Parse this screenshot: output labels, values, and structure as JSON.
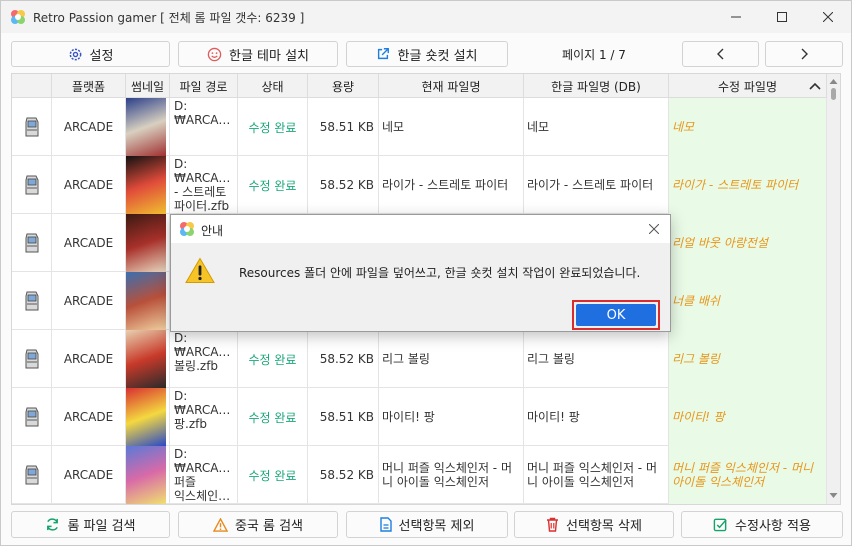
{
  "window": {
    "title": "Retro Passion gamer [ 전체 롬 파일 갯수: 6239 ]"
  },
  "toolbar": {
    "settings_label": "설정",
    "korean_theme_label": "한글 테마 설치",
    "korean_shortcut_label": "한글 숏컷 설치",
    "page_info": "페이지 1 / 7"
  },
  "table": {
    "columns": [
      "플랫폼",
      "썸네일",
      "파일 경로",
      "상태",
      "용량",
      "현재 파일명",
      "한글 파일명 (DB)",
      "수정 파일명"
    ],
    "rows": [
      {
        "platform": "ARCADE",
        "path": "D:\n₩ARCA…",
        "status": "수정 완료",
        "size": "58.51 KB",
        "current": "네모",
        "db": "네모",
        "fixed": "네모"
      },
      {
        "platform": "ARCADE",
        "path": "D:\n₩ARCA…\n- 스트레토\n파이터.zfb",
        "status": "수정 완료",
        "size": "58.52 KB",
        "current": "라이가 - 스트레토 파이터",
        "db": "라이가 - 스트레토 파이터",
        "fixed": "라이가 - 스트레토 파이터"
      },
      {
        "platform": "ARCADE",
        "path": "",
        "status": "",
        "size": "",
        "current": "",
        "db": "",
        "fixed": "리얼 바웃 아랑전설"
      },
      {
        "platform": "ARCADE",
        "path": "",
        "status": "",
        "size": "",
        "current": "",
        "db": "",
        "fixed": "너클 배쉬"
      },
      {
        "platform": "ARCADE",
        "path": "D:\n₩ARCA…\n볼링.zfb",
        "status": "수정 완료",
        "size": "58.52 KB",
        "current": "리그 볼링",
        "db": "리그 볼링",
        "fixed": "리그 볼링"
      },
      {
        "platform": "ARCADE",
        "path": "D:\n₩ARCA…\n팡.zfb",
        "status": "수정 완료",
        "size": "58.51 KB",
        "current": "마이티! 팡",
        "db": "마이티! 팡",
        "fixed": "마이티! 팡"
      },
      {
        "platform": "ARCADE",
        "path": "D:\n₩ARCA…\n퍼즐\n익스체인…",
        "status": "수정 완료",
        "size": "58.52 KB",
        "current": "머니 퍼즐 익스체인저 - 머니 아이돌 익스체인저",
        "db": "머니 퍼즐 익스체인저 - 머니 아이돌 익스체인저",
        "fixed": "머니 퍼즐 익스체인저 - 머니 아이돌 익스체인저"
      }
    ]
  },
  "dialog": {
    "title": "안내",
    "message": "Resources 폴더 안에 파일을 덮어쓰고, 한글 숏컷 설치 작업이 완료되었습니다.",
    "ok_label": "OK"
  },
  "bottom": {
    "rom_search": "롬 파일 검색",
    "cn_rom_search": "중국 롬 검색",
    "exclude": "선택항목 제외",
    "delete": "선택항목 삭제",
    "apply": "수정사항 적용"
  }
}
